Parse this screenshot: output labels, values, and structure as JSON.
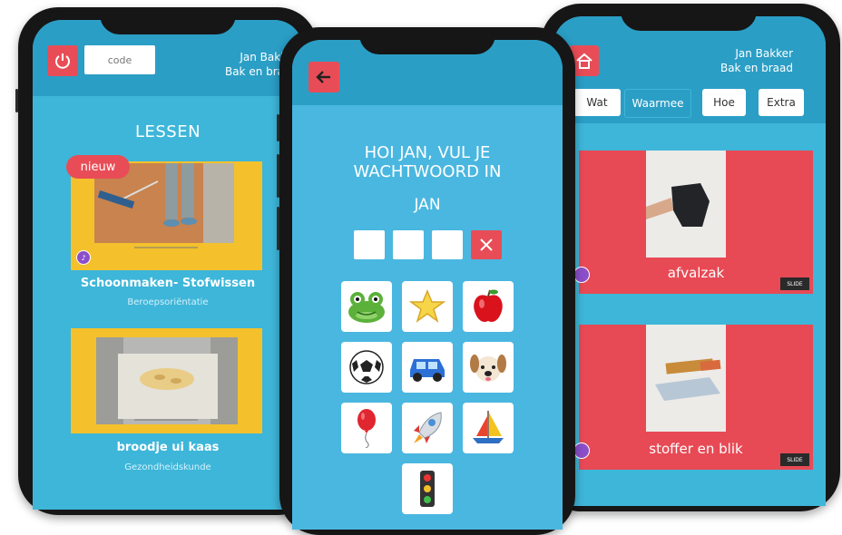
{
  "colors": {
    "accent_red": "#e84d57",
    "screen_blue": "#3eb6d9",
    "header_blue": "#2b9ec6",
    "card_yellow": "#f4c12c"
  },
  "phone_lessons": {
    "code_placeholder": "code",
    "user_name": "Jan Bakker",
    "user_group": "Bak en braad",
    "section_title": "LESSEN",
    "lessons": [
      {
        "badge": "nieuw",
        "title": "Schoonmaken- Stofwissen",
        "subtitle": "Beroepsoriëntatie"
      },
      {
        "title": "broodje ui kaas",
        "subtitle": "Gezondheidskunde"
      }
    ]
  },
  "phone_login": {
    "greeting_line1": "HOI JAN, VUL JE",
    "greeting_line2": "WACHTWOORD IN",
    "name": "JAN",
    "icons": [
      "frog-icon",
      "star-icon",
      "apple-icon",
      "soccer-ball-icon",
      "car-icon",
      "dog-icon",
      "balloon-icon",
      "rocket-icon",
      "sailboat-icon",
      "traffic-light-icon"
    ]
  },
  "phone_words": {
    "user_name": "Jan Bakker",
    "user_group": "Bak en braad",
    "tabs": [
      "Wat",
      "Waarmee",
      "Hoe",
      "Extra"
    ],
    "active_tab": "Waarmee",
    "words": [
      {
        "label": "afvalzak",
        "badge": "SLIDE"
      },
      {
        "label": "stoffer en blik",
        "badge": "SLIDE"
      }
    ]
  }
}
